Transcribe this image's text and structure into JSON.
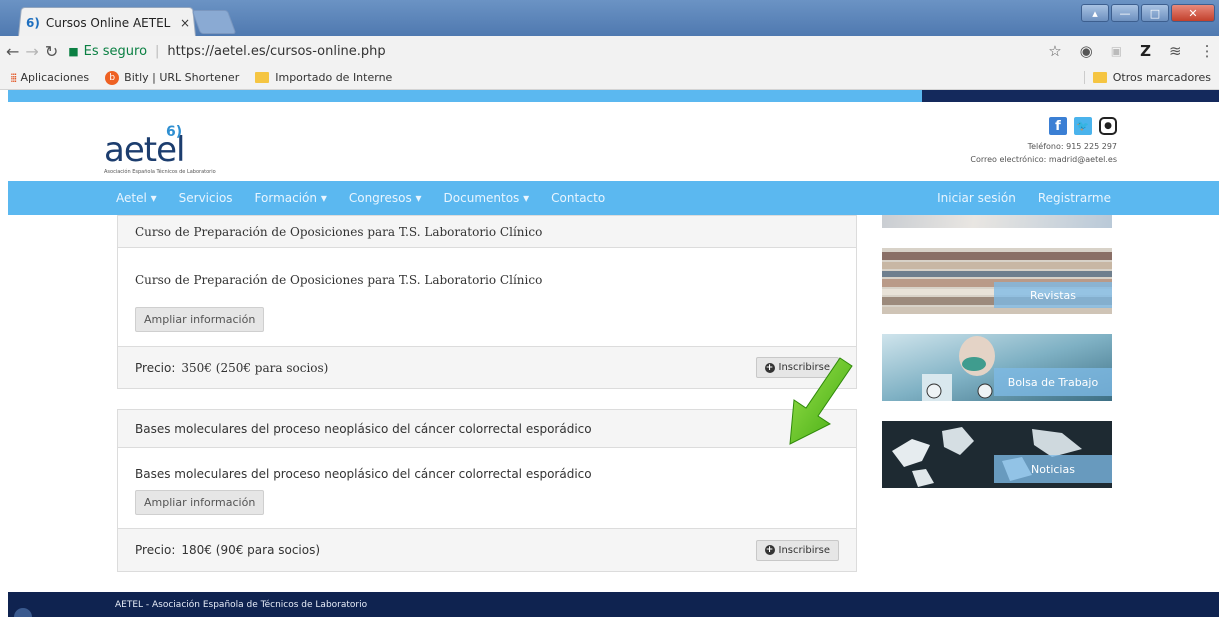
{
  "browser": {
    "tab_title": "Cursos Online AETEL",
    "tab_close": "×",
    "tab_favicon": "6)",
    "secure_label": "Es seguro",
    "url": "https://aetel.es/cursos-online.php",
    "bookmarks": [
      "Aplicaciones",
      "Bitly | URL Shortener",
      "Importado de Interne"
    ],
    "other_bookmarks": "Otros marcadores"
  },
  "site": {
    "logo_mark": "6)",
    "logo_text": "aetel",
    "logo_subtitle": "Asociación Española Técnicos de Laboratorio",
    "phone": "Teléfono: 915 225 297",
    "email": "Correo electrónico: madrid@aetel.es",
    "nav_left": [
      "Aetel ▾",
      "Servicios",
      "Formación ▾",
      "Congresos ▾",
      "Documentos ▾",
      "Contacto"
    ],
    "nav_right": [
      "Iniciar sesión",
      "Registrarme"
    ]
  },
  "courses": [
    {
      "header": "Curso de Preparación de Oposiciones para T.S. Laboratorio Clínico",
      "description": "Curso de Preparación de Oposiciones para T.S. Laboratorio Clínico",
      "more_label": "Ampliar información",
      "price_label": "Precio:",
      "price_value": "350€ (250€ para socios)",
      "enroll_label": "Inscribirse"
    },
    {
      "header": "Bases moleculares del proceso neoplásico del cáncer colorrectal esporádico",
      "description": "Bases moleculares del proceso neoplásico del cáncer colorrectal esporádico",
      "more_label": "Ampliar información",
      "price_label": "Precio:",
      "price_value": "180€ (90€ para socios)",
      "enroll_label": "Inscribirse"
    }
  ],
  "sidebar": {
    "banners": [
      "Revistas",
      "Bolsa de Trabajo",
      "Noticias"
    ]
  },
  "footer": {
    "text": "AETEL - Asociación Española de Técnicos de Laboratorio"
  },
  "colors": {
    "nav_blue": "#5bb8f0",
    "dark_navy": "#14295c",
    "arrow_green": "#5fc71d"
  }
}
